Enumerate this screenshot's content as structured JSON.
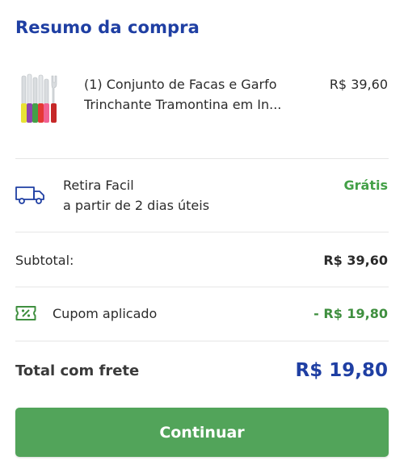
{
  "summary": {
    "title": "Resumo da compra"
  },
  "product": {
    "name_line1": "(1) Conjunto de Facas e Garfo",
    "name_line2": "Trinchante Tramontina em In...",
    "price": "R$ 39,60",
    "image_icon": "knife-set-thumbnail",
    "handle_colors": [
      "#e8e234",
      "#8e44ad",
      "#43a047",
      "#e53935",
      "#f06292"
    ]
  },
  "shipping": {
    "method": "Retira Facil",
    "eta": "a partir de 2 dias úteis",
    "price": "Grátis",
    "icon": "truck-icon"
  },
  "subtotal": {
    "label": "Subtotal:",
    "value": "R$ 39,60"
  },
  "coupon": {
    "label": "Cupom aplicado",
    "value": "- R$ 19,80",
    "icon": "coupon-percent-icon"
  },
  "total": {
    "label": "Total com frete",
    "value": "R$ 19,80"
  },
  "actions": {
    "continue_label": "Continuar"
  },
  "colors": {
    "brand_blue": "#1f3fa3",
    "success_green": "#43a047",
    "button_green": "#52a45a"
  }
}
